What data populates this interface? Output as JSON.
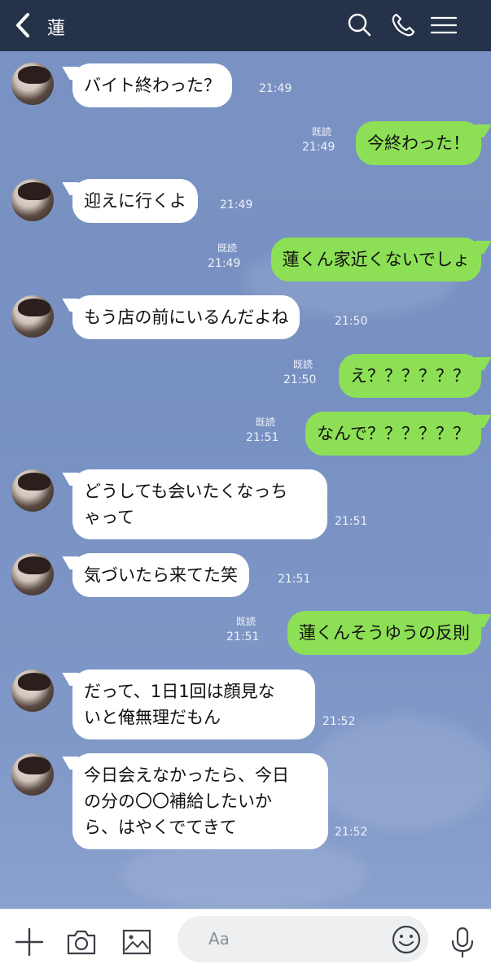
{
  "header": {
    "title": "蓮"
  },
  "messages": [
    {
      "side": "in",
      "text": "バイト終わった？",
      "time": "21:49"
    },
    {
      "side": "out",
      "text": "今終わった！",
      "time": "21:49",
      "read": "既読"
    },
    {
      "side": "in",
      "text": "迎えに行くよ",
      "time": "21:49"
    },
    {
      "side": "out",
      "text": "蓮くん家近くないでしょ",
      "time": "21:49",
      "read": "既読"
    },
    {
      "side": "in",
      "text": "もう店の前にいるんだよね",
      "time": "21:50"
    },
    {
      "side": "out",
      "text": "え？？？？？？",
      "time": "21:50",
      "read": "既読"
    },
    {
      "side": "out",
      "text": "なんで？？？？？？",
      "time": "21:51",
      "read": "既読"
    },
    {
      "side": "in",
      "text": "どうしても会いたくなっち\nゃって",
      "time": "21:51"
    },
    {
      "side": "in",
      "text": "気づいたら来てた笑",
      "time": "21:51"
    },
    {
      "side": "out",
      "text": "蓮くんそうゆうの反則",
      "time": "21:51",
      "read": "既読"
    },
    {
      "side": "in",
      "text": "だって、1日1回は顔見な\nいと俺無理だもん",
      "time": "21:52"
    },
    {
      "side": "in",
      "text": "今日会えなかったら、今日\nの分の〇〇補給したいか\nら、はやくでてきて",
      "time": "21:52"
    }
  ],
  "composer": {
    "placeholder": "Aa"
  },
  "icons": {
    "back": "back-chevron-icon",
    "search": "search-icon",
    "call": "phone-icon",
    "menu": "menu-icon",
    "add": "plus-icon",
    "camera": "camera-icon",
    "image": "image-icon",
    "emoji": "emoji-icon",
    "mic": "microphone-icon"
  },
  "colors": {
    "header_bg": "#263249",
    "outgoing_bubble": "#8de055",
    "incoming_bubble": "#ffffff"
  }
}
